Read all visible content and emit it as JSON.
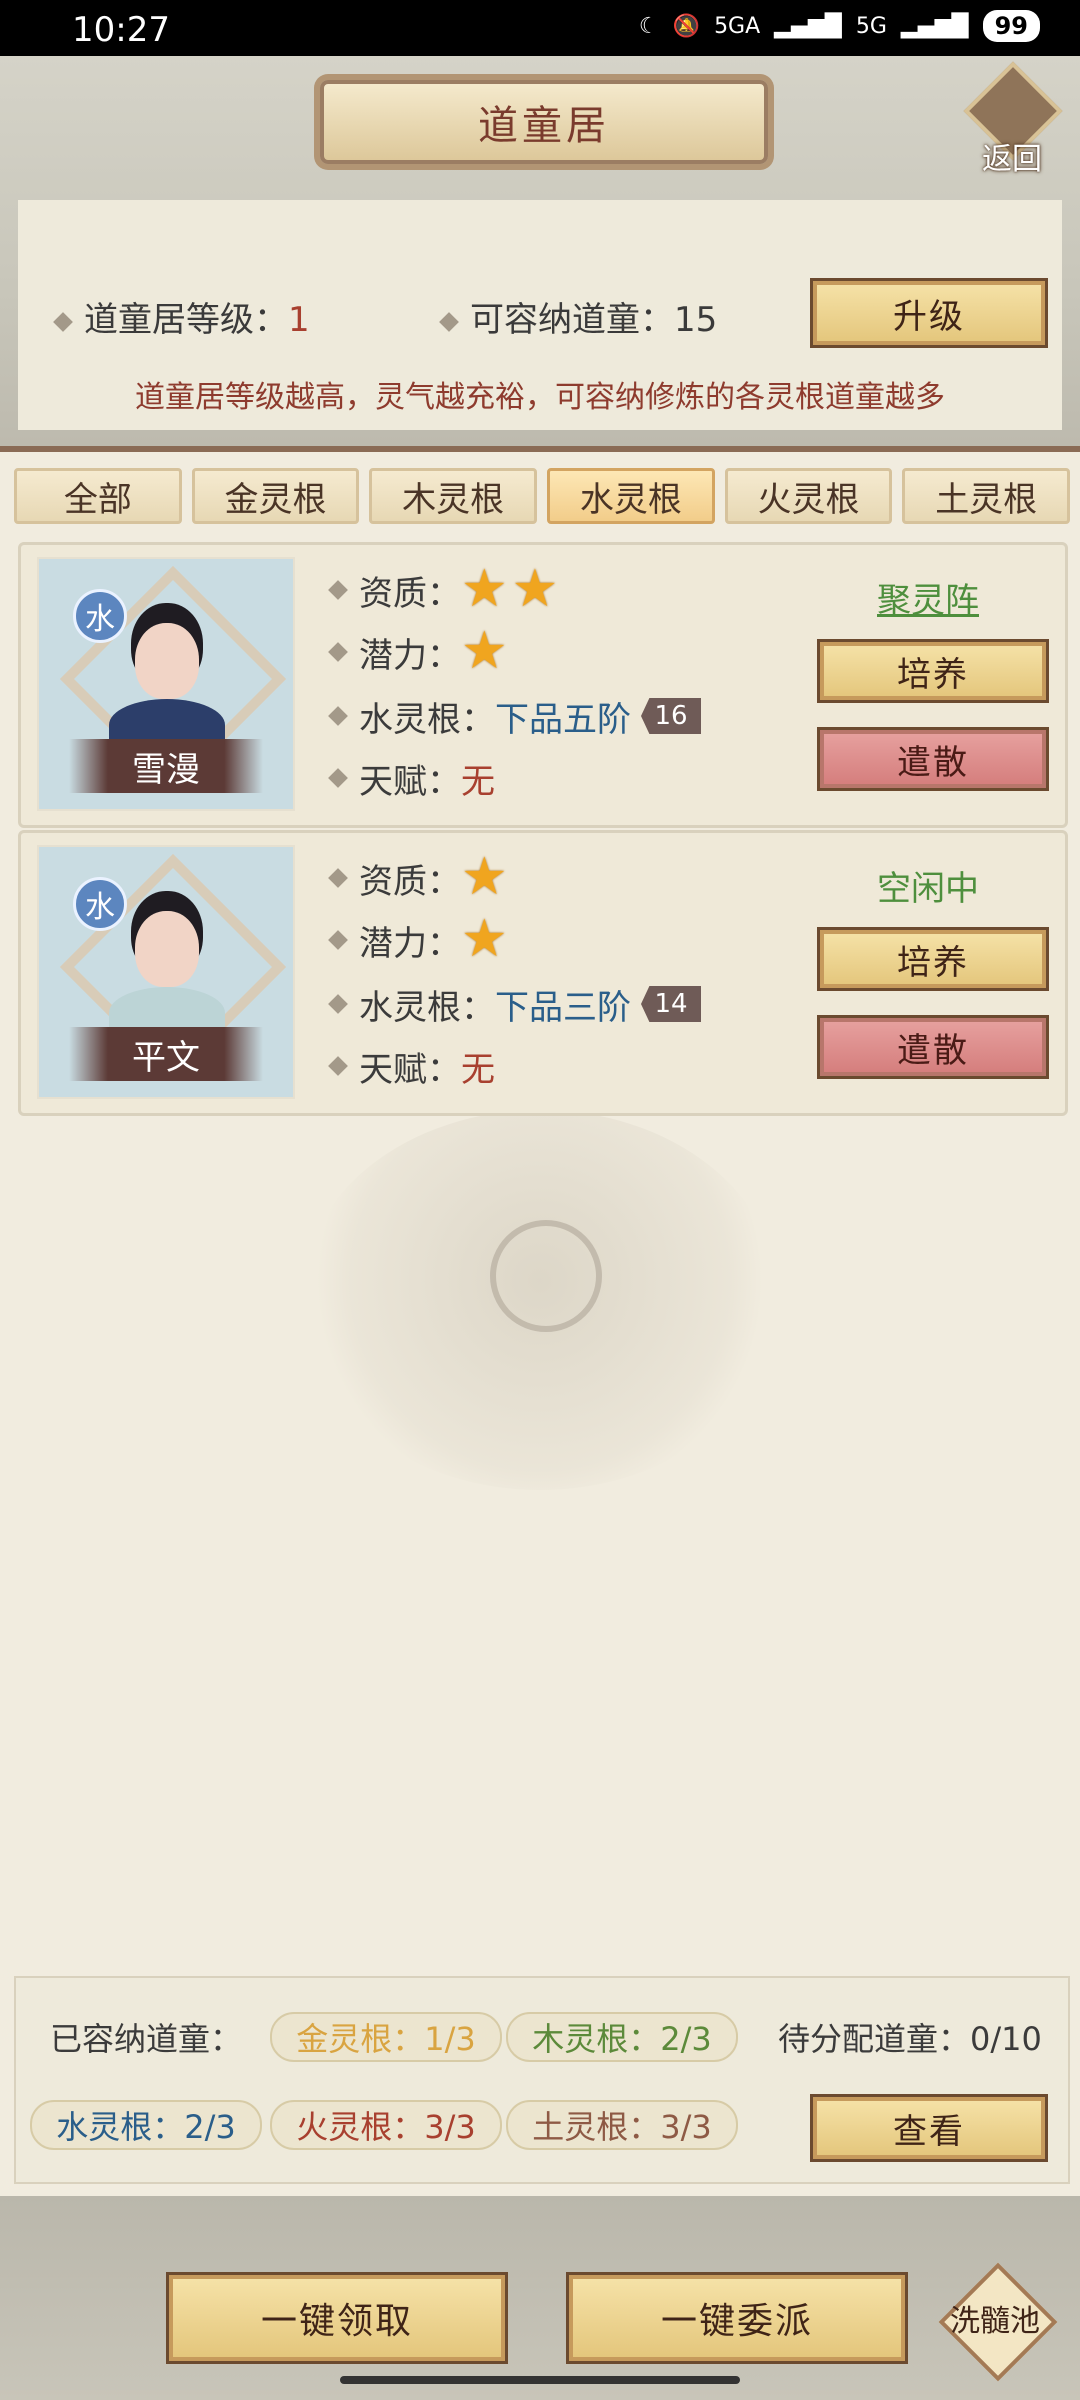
{
  "status_bar": {
    "time": "10:27",
    "network1": "5GA",
    "network2": "5G",
    "battery": "99"
  },
  "header": {
    "title": "道童居",
    "back_label": "返回"
  },
  "info": {
    "level_label": "道童居等级：",
    "level_value": "1",
    "capacity_label": "可容纳道童：",
    "capacity_value": "15",
    "upgrade_label": "升级",
    "tip": "道童居等级越高，灵气越充裕，可容纳修炼的各灵根道童越多"
  },
  "tabs": [
    {
      "label": "全部",
      "active": false
    },
    {
      "label": "金灵根",
      "active": false
    },
    {
      "label": "木灵根",
      "active": false
    },
    {
      "label": "水灵根",
      "active": true
    },
    {
      "label": "火灵根",
      "active": false
    },
    {
      "label": "土灵根",
      "active": false
    }
  ],
  "cards": [
    {
      "element": "水",
      "name": "雪漫",
      "aptitude_label": "资质：",
      "aptitude_stars": 2,
      "potential_label": "潜力：",
      "potential_stars": 1,
      "root_label": "水灵根：",
      "root_value": "下品五阶",
      "root_level": "16",
      "talent_label": "天赋：",
      "talent_value": "无",
      "status": "聚灵阵",
      "train_label": "培养",
      "dismiss_label": "遣散"
    },
    {
      "element": "水",
      "name": "平文",
      "aptitude_label": "资质：",
      "aptitude_stars": 1,
      "potential_label": "潜力：",
      "potential_stars": 1,
      "root_label": "水灵根：",
      "root_value": "下品三阶",
      "root_level": "14",
      "talent_label": "天赋：",
      "talent_value": "无",
      "status": "空闲中",
      "train_label": "培养",
      "dismiss_label": "遣散"
    }
  ],
  "summary": {
    "held_label": "已容纳道童：",
    "gold": "金灵根：1/3",
    "wood": "木灵根：2/3",
    "pending": "待分配道童：0/10",
    "water": "水灵根：2/3",
    "fire": "火灵根：3/3",
    "earth": "土灵根：3/3",
    "view_label": "查看"
  },
  "footer": {
    "collect_all": "一键领取",
    "dispatch_all": "一键委派",
    "pool": "洗髓池"
  },
  "colors": {
    "gold_text": "#d9a441",
    "wood_text": "#5c8a3a",
    "water_text": "#2a5e8a",
    "fire_text": "#a8402f",
    "earth_text": "#8e5a45"
  }
}
